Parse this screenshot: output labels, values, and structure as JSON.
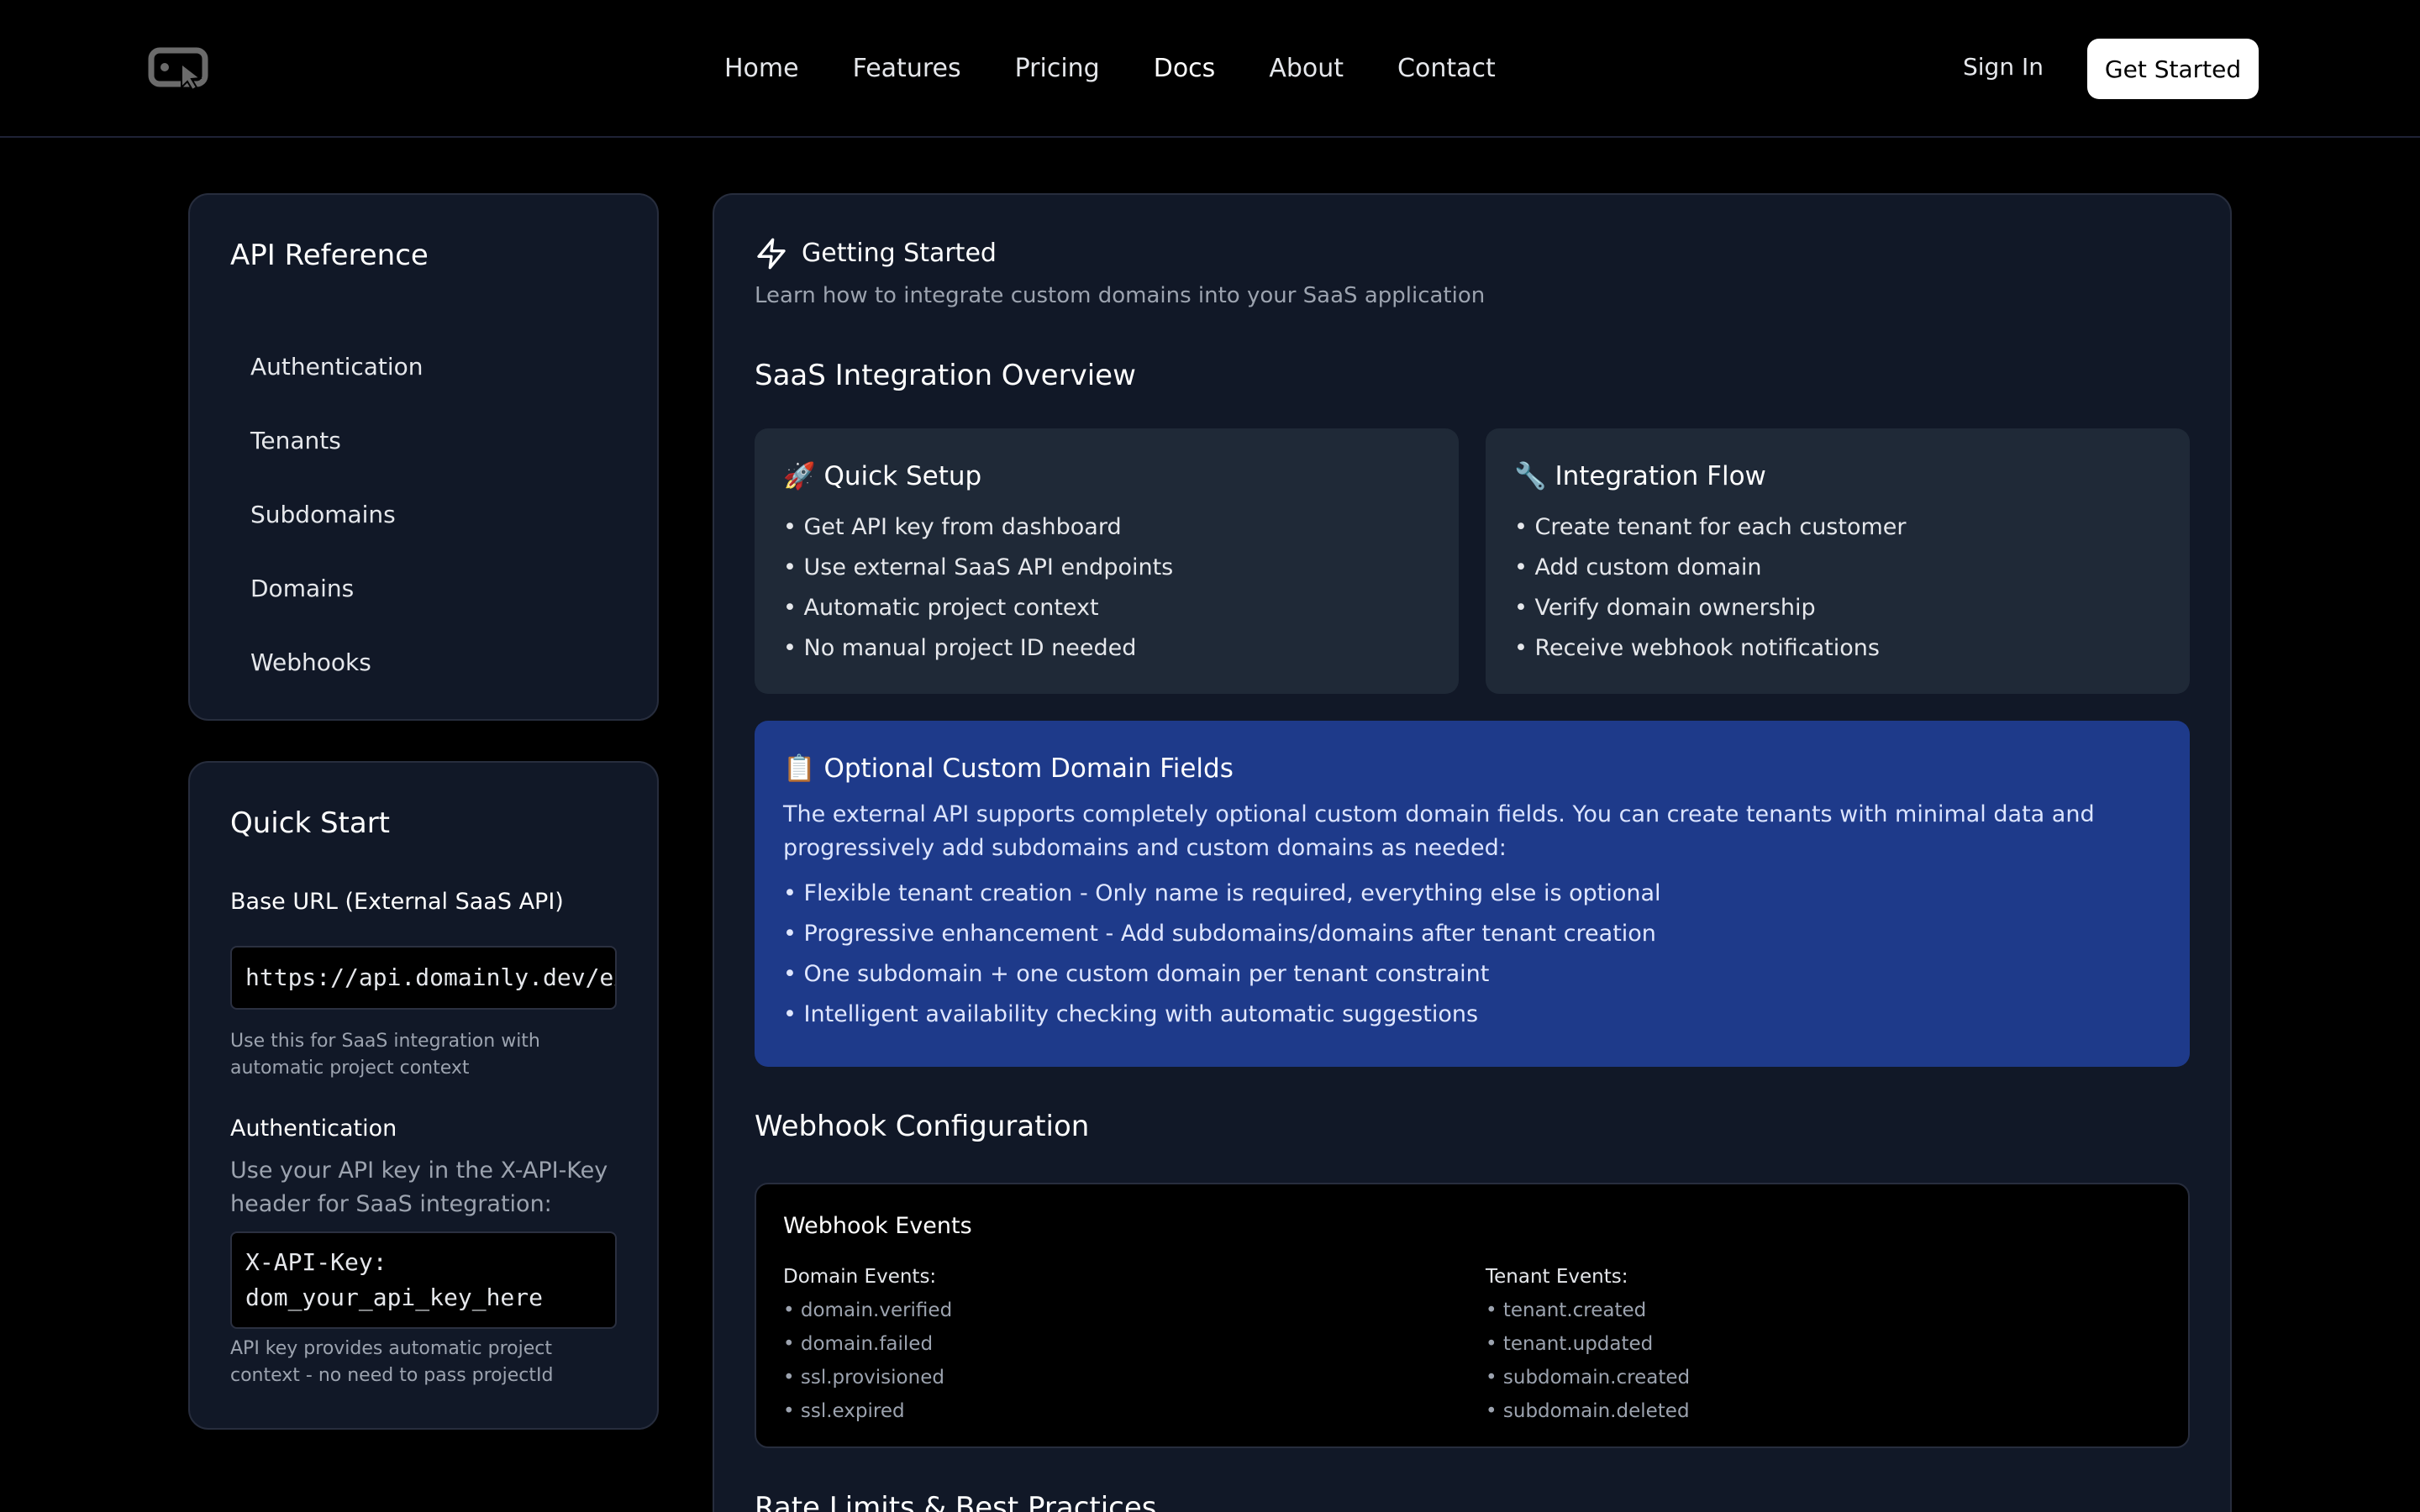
{
  "header": {
    "nav": [
      "Home",
      "Features",
      "Pricing",
      "Docs",
      "About",
      "Contact"
    ],
    "active_nav": "Docs",
    "sign_in": "Sign In",
    "get_started": "Get Started"
  },
  "sidebar": {
    "api_title": "API Reference",
    "api_items": [
      "Authentication",
      "Tenants",
      "Subdomains",
      "Domains",
      "Webhooks"
    ],
    "quick_start": {
      "title": "Quick Start",
      "base_url_label": "Base URL (External SaaS API)",
      "base_url_value": "https://api.domainly.dev/external",
      "base_url_note": "Use this for SaaS integration with automatic project context",
      "auth_label": "Authentication",
      "auth_desc": "Use your API key in the X-API-Key header for SaaS integration:",
      "auth_code_line1": "X-API-Key:",
      "auth_code_line2": "dom_your_api_key_here",
      "auth_note": "API key provides automatic project context - no need to pass projectId"
    }
  },
  "main": {
    "getting_started_icon": "lightning-icon",
    "getting_started_title": "Getting Started",
    "getting_started_sub": "Learn how to integrate custom domains into your SaaS application",
    "overview_title": "SaaS Integration Overview",
    "quick_setup": {
      "title": "🚀 Quick Setup",
      "items": [
        "• Get API key from dashboard",
        "• Use external SaaS API endpoints",
        "• Automatic project context",
        "• No manual project ID needed"
      ]
    },
    "integration_flow": {
      "title": "🔧 Integration Flow",
      "items": [
        "• Create tenant for each customer",
        "• Add custom domain",
        "• Verify domain ownership",
        "• Receive webhook notifications"
      ]
    },
    "optional_fields": {
      "title": "📋 Optional Custom Domain Fields",
      "description": "The external API supports completely optional custom domain fields. You can create tenants with minimal data and progressively add subdomains and custom domains as needed:",
      "items": [
        "• Flexible tenant creation - Only name is required, everything else is optional",
        "• Progressive enhancement - Add subdomains/domains after tenant creation",
        "• One subdomain + one custom domain per tenant constraint",
        "• Intelligent availability checking with automatic suggestions"
      ],
      "bg_color": "#1e3a8a"
    },
    "webhook_title": "Webhook Configuration",
    "webhook_events": {
      "title": "Webhook Events",
      "domain_heading": "Domain Events:",
      "domain_events": [
        "• domain.verified",
        "• domain.failed",
        "• ssl.provisioned",
        "• ssl.expired"
      ],
      "tenant_heading": "Tenant Events:",
      "tenant_events": [
        "• tenant.created",
        "• tenant.updated",
        "• subdomain.created",
        "• subdomain.deleted"
      ]
    },
    "rate_limits_title": "Rate Limits & Best Practices"
  },
  "colors": {
    "page_bg": "#000000",
    "card_bg": "#111827",
    "inner_box_bg": "#1f2937",
    "muted_text": "#9ca3af"
  }
}
